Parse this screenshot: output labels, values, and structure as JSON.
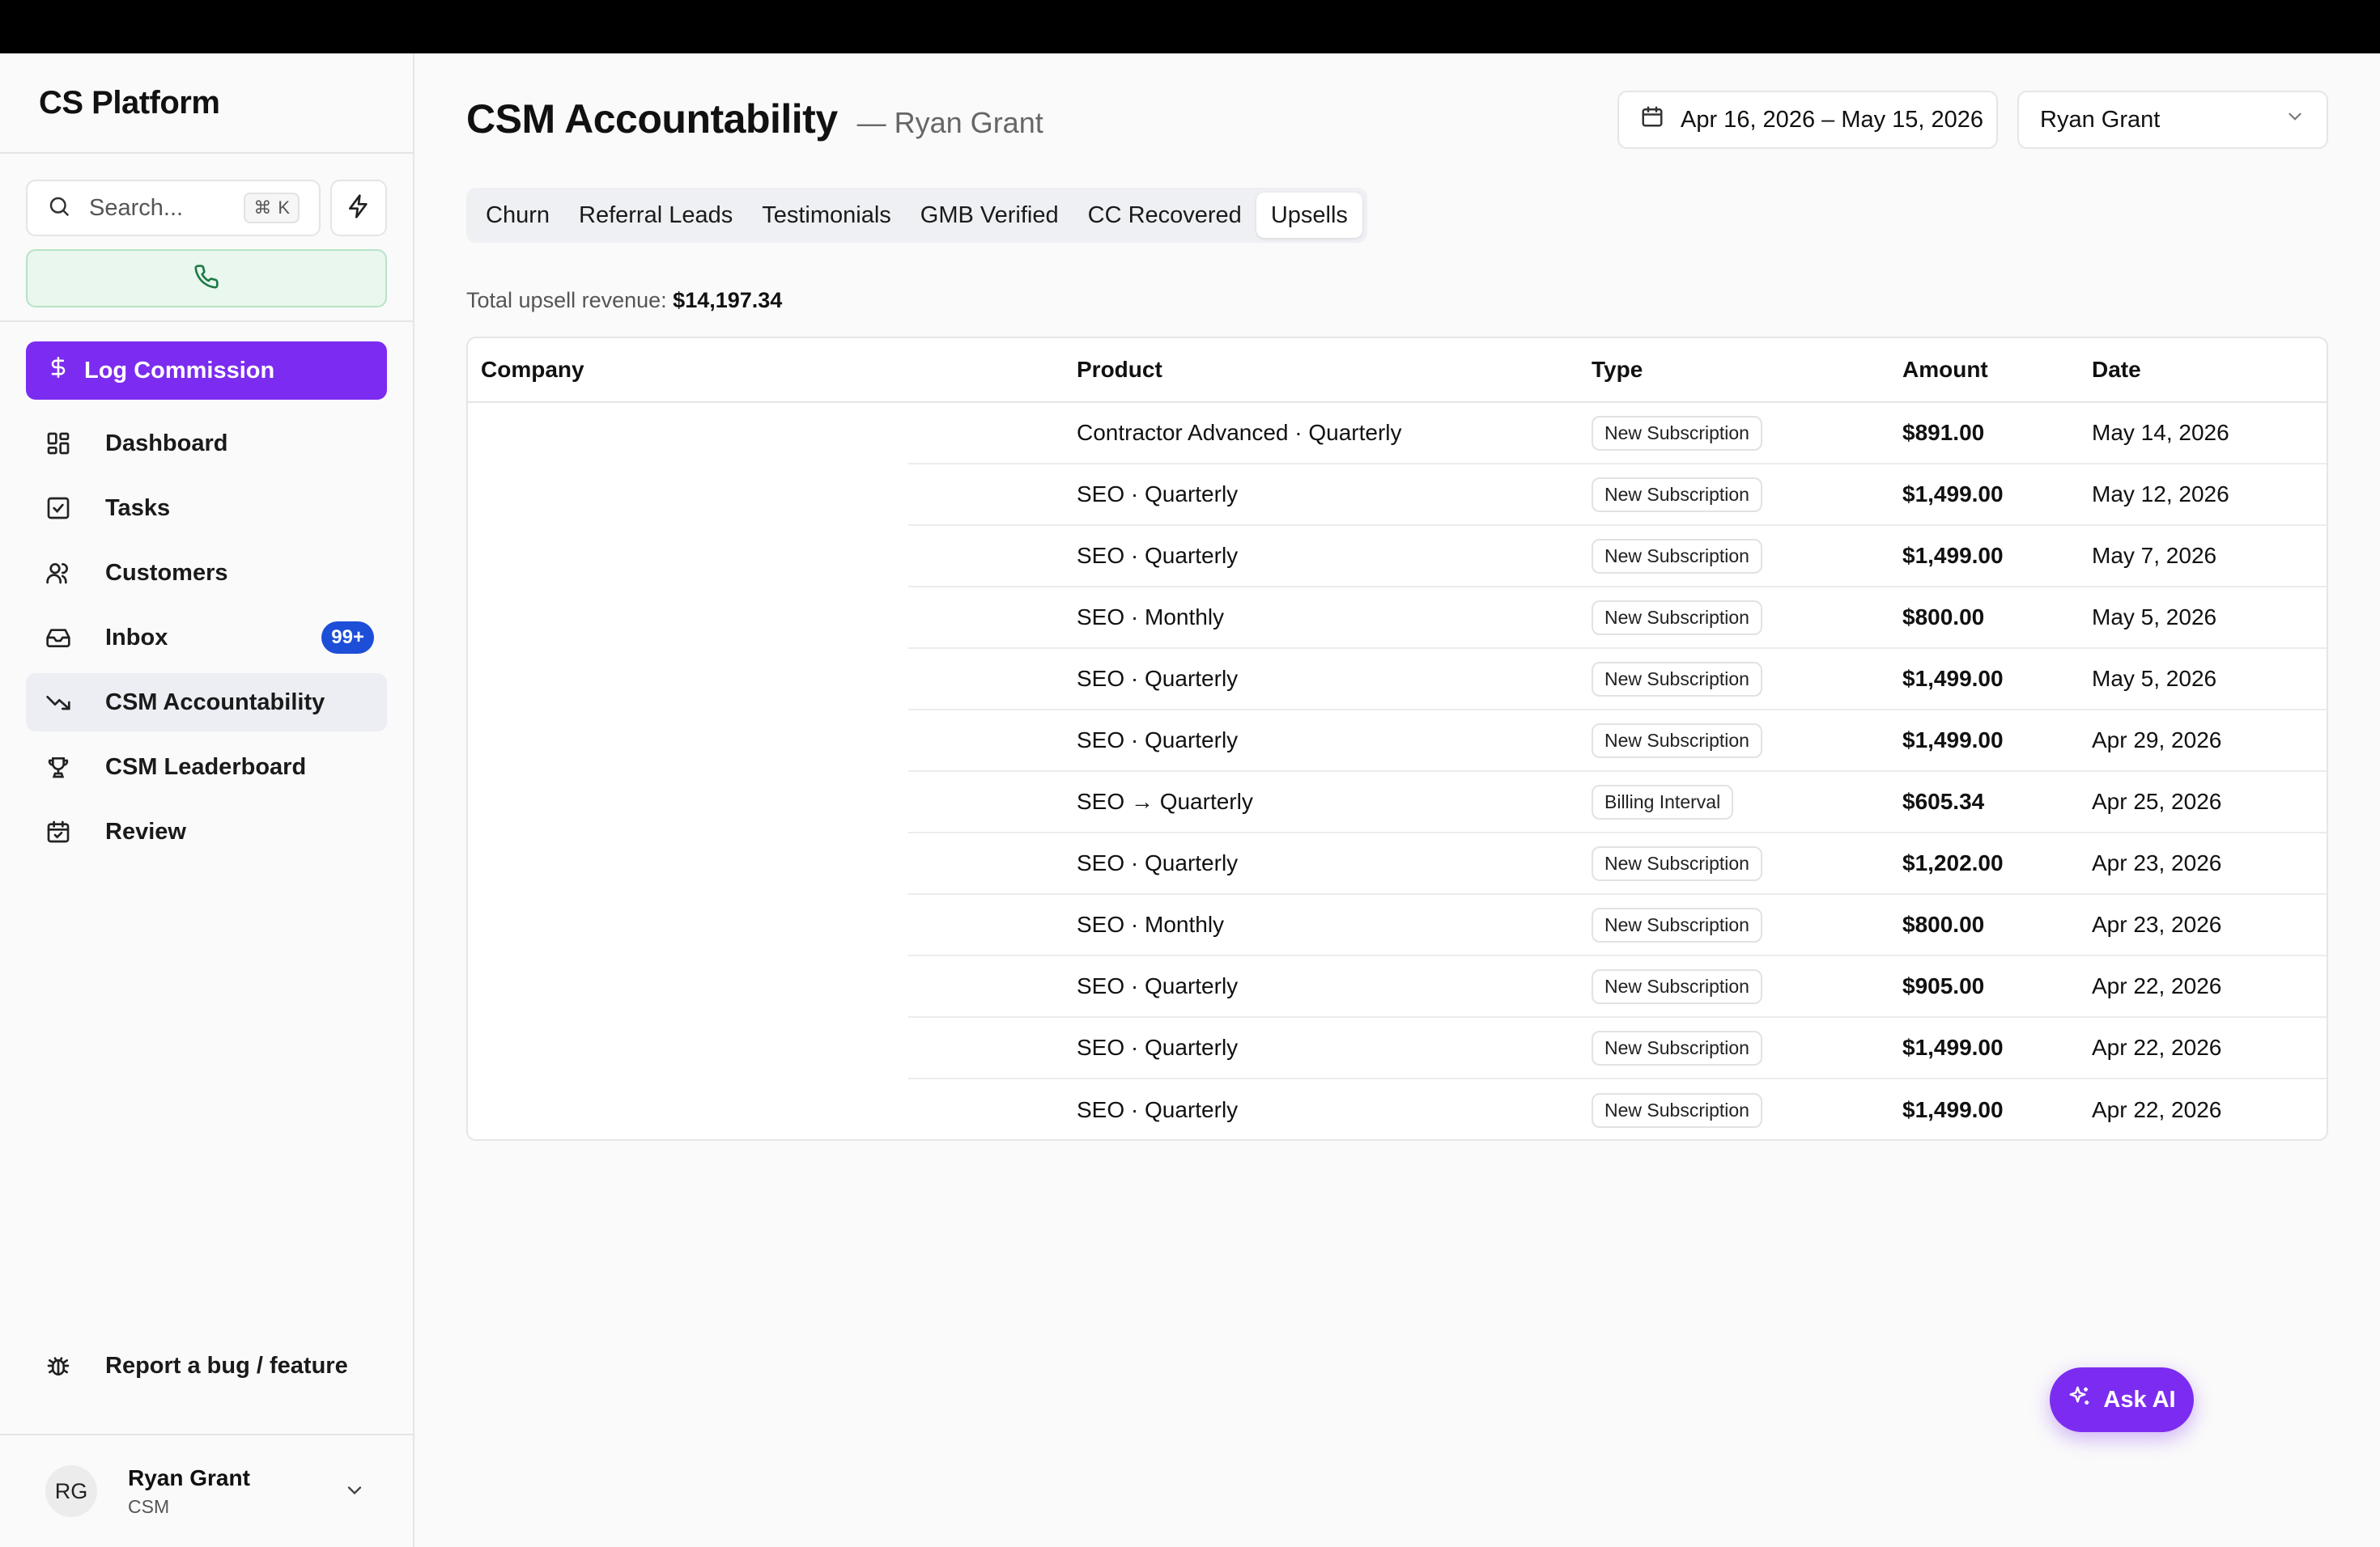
{
  "app": {
    "brand": "CS Platform"
  },
  "sidebar": {
    "search_placeholder": "Search...",
    "search_shortcut_symbol": "⌘",
    "search_shortcut_key": "K",
    "log_commission_label": "Log Commission",
    "nav": [
      {
        "label": "Dashboard",
        "icon": "grid-icon"
      },
      {
        "label": "Tasks",
        "icon": "checkbox-icon"
      },
      {
        "label": "Customers",
        "icon": "users-icon"
      },
      {
        "label": "Inbox",
        "icon": "inbox-icon",
        "badge": "99+"
      },
      {
        "label": "CSM Accountability",
        "icon": "trending-down-icon",
        "active": true
      },
      {
        "label": "CSM Leaderboard",
        "icon": "trophy-icon"
      },
      {
        "label": "Review",
        "icon": "calendar-check-icon"
      }
    ],
    "report_label": "Report a bug / feature",
    "user": {
      "initials": "RG",
      "name": "Ryan Grant",
      "role": "CSM"
    }
  },
  "header": {
    "title": "CSM Accountability",
    "subtitle": "— Ryan Grant",
    "date_range": "Apr 16, 2026 – May 15, 2026",
    "selected_user": "Ryan Grant"
  },
  "tabs": [
    "Churn",
    "Referral Leads",
    "Testimonials",
    "GMB Verified",
    "CC Recovered",
    "Upsells"
  ],
  "active_tab": "Upsells",
  "summary": {
    "label": "Total upsell revenue:",
    "value": "$14,197.34"
  },
  "table": {
    "columns": [
      "Company",
      "Product",
      "Type",
      "Amount",
      "Date"
    ],
    "rows": [
      {
        "company": "",
        "product": "Contractor Advanced · Quarterly",
        "type": "New Subscription",
        "amount": "$891.00",
        "date": "May 14, 2026"
      },
      {
        "company": "",
        "product": "SEO · Quarterly",
        "type": "New Subscription",
        "amount": "$1,499.00",
        "date": "May 12, 2026"
      },
      {
        "company": "",
        "product": "SEO · Quarterly",
        "type": "New Subscription",
        "amount": "$1,499.00",
        "date": "May 7, 2026"
      },
      {
        "company": "",
        "product": "SEO · Monthly",
        "type": "New Subscription",
        "amount": "$800.00",
        "date": "May 5, 2026"
      },
      {
        "company": "",
        "product": "SEO · Quarterly",
        "type": "New Subscription",
        "amount": "$1,499.00",
        "date": "May 5, 2026"
      },
      {
        "company": "",
        "product": "SEO · Quarterly",
        "type": "New Subscription",
        "amount": "$1,499.00",
        "date": "Apr 29, 2026"
      },
      {
        "company": "",
        "product": "SEO → Quarterly",
        "type": "Billing Interval",
        "amount": "$605.34",
        "date": "Apr 25, 2026"
      },
      {
        "company": "",
        "product": "SEO · Quarterly",
        "type": "New Subscription",
        "amount": "$1,202.00",
        "date": "Apr 23, 2026"
      },
      {
        "company": "",
        "product": "SEO · Monthly",
        "type": "New Subscription",
        "amount": "$800.00",
        "date": "Apr 23, 2026"
      },
      {
        "company": "",
        "product": "SEO · Quarterly",
        "type": "New Subscription",
        "amount": "$905.00",
        "date": "Apr 22, 2026"
      },
      {
        "company": "",
        "product": "SEO · Quarterly",
        "type": "New Subscription",
        "amount": "$1,499.00",
        "date": "Apr 22, 2026"
      },
      {
        "company": "",
        "product": "SEO · Quarterly",
        "type": "New Subscription",
        "amount": "$1,499.00",
        "date": "Apr 22, 2026"
      }
    ]
  },
  "ask_ai_label": "Ask AI",
  "colors": {
    "accent": "#7c2cf0",
    "badge": "#1d4ed8",
    "call_bg": "#e9f7ee",
    "call_icon": "#1f7a45"
  }
}
